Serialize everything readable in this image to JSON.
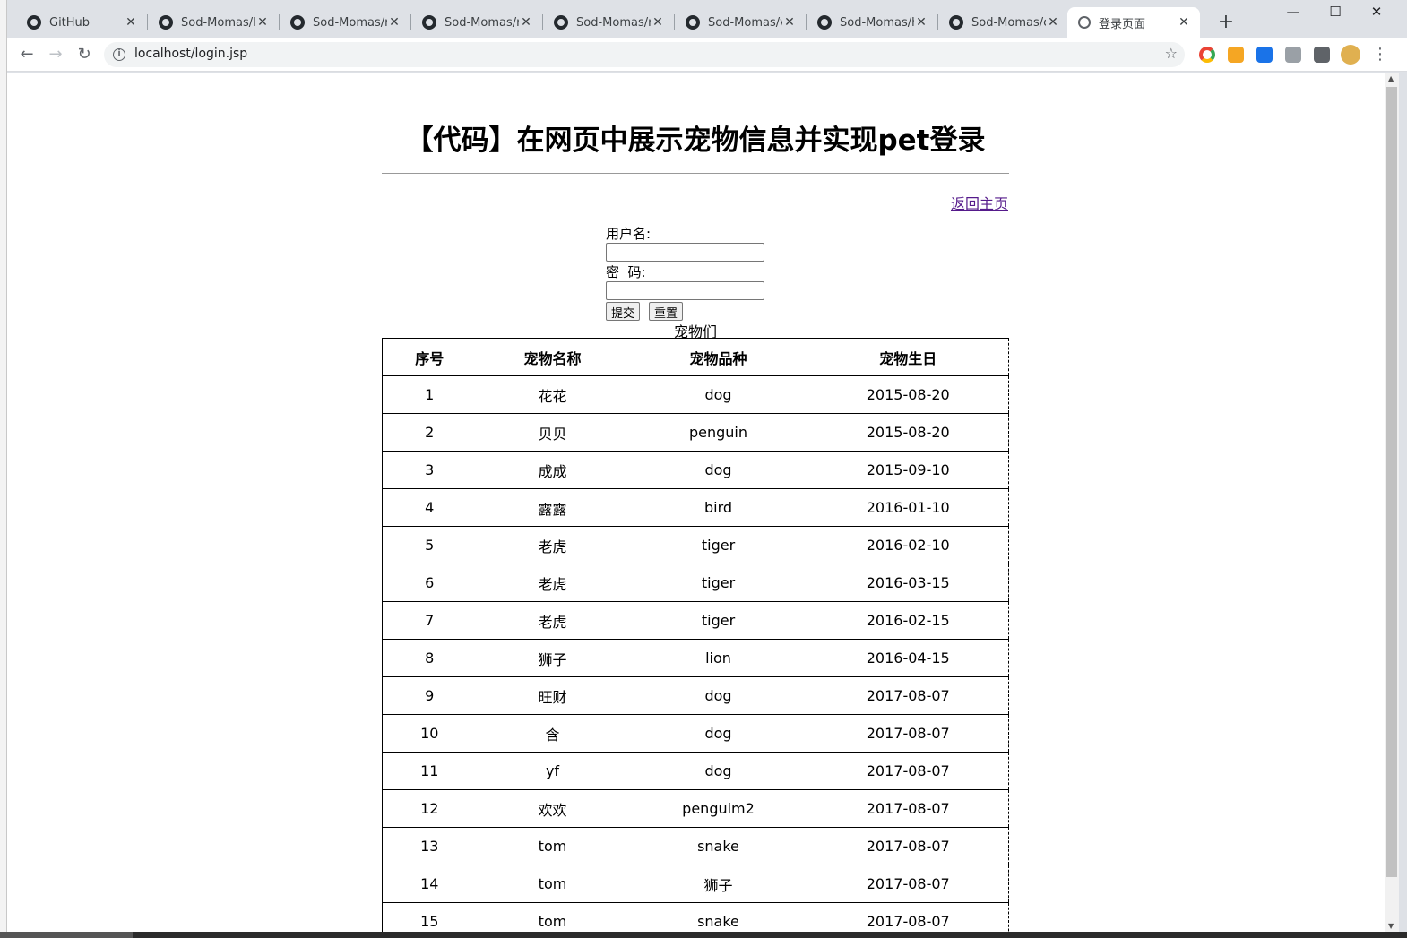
{
  "browser": {
    "tabs": [
      {
        "title": "GitHub"
      },
      {
        "title": "Sod-Momas/P"
      },
      {
        "title": "Sod-Momas/r"
      },
      {
        "title": "Sod-Momas/n"
      },
      {
        "title": "Sod-Momas/n"
      },
      {
        "title": "Sod-Momas/v"
      },
      {
        "title": "Sod-Momas/h"
      },
      {
        "title": "Sod-Momas/c"
      }
    ],
    "active_tab": {
      "title": "登录页面"
    },
    "url": "localhost/login.jsp"
  },
  "page": {
    "title": "【代码】在网页中展示宠物信息并实现pet登录",
    "home_link": "返回主页",
    "form": {
      "username_label": "用户名:",
      "password_label": "密  码:",
      "submit_label": "提交",
      "reset_label": "重置"
    },
    "table": {
      "caption": "宠物们",
      "headers": [
        "序号",
        "宠物名称",
        "宠物品种",
        "宠物生日"
      ],
      "rows": [
        [
          "1",
          "花花",
          "dog",
          "2015-08-20"
        ],
        [
          "2",
          "贝贝",
          "penguin",
          "2015-08-20"
        ],
        [
          "3",
          "成成",
          "dog",
          "2015-09-10"
        ],
        [
          "4",
          "露露",
          "bird",
          "2016-01-10"
        ],
        [
          "5",
          "老虎",
          "tiger",
          "2016-02-10"
        ],
        [
          "6",
          "老虎",
          "tiger",
          "2016-03-15"
        ],
        [
          "7",
          "老虎",
          "tiger",
          "2016-02-15"
        ],
        [
          "8",
          "狮子",
          "lion",
          "2016-04-15"
        ],
        [
          "9",
          "旺财",
          "dog",
          "2017-08-07"
        ],
        [
          "10",
          "含",
          "dog",
          "2017-08-07"
        ],
        [
          "11",
          "yf",
          "dog",
          "2017-08-07"
        ],
        [
          "12",
          "欢欢",
          "penguim2",
          "2017-08-07"
        ],
        [
          "13",
          "tom",
          "snake",
          "2017-08-07"
        ],
        [
          "14",
          "tom",
          "狮子",
          "2017-08-07"
        ],
        [
          "15",
          "tom",
          "snake",
          "2017-08-07"
        ]
      ]
    }
  },
  "colors": {
    "tabstrip": "#dee1e6",
    "link_visited": "#551a8b",
    "text": "#000000"
  }
}
